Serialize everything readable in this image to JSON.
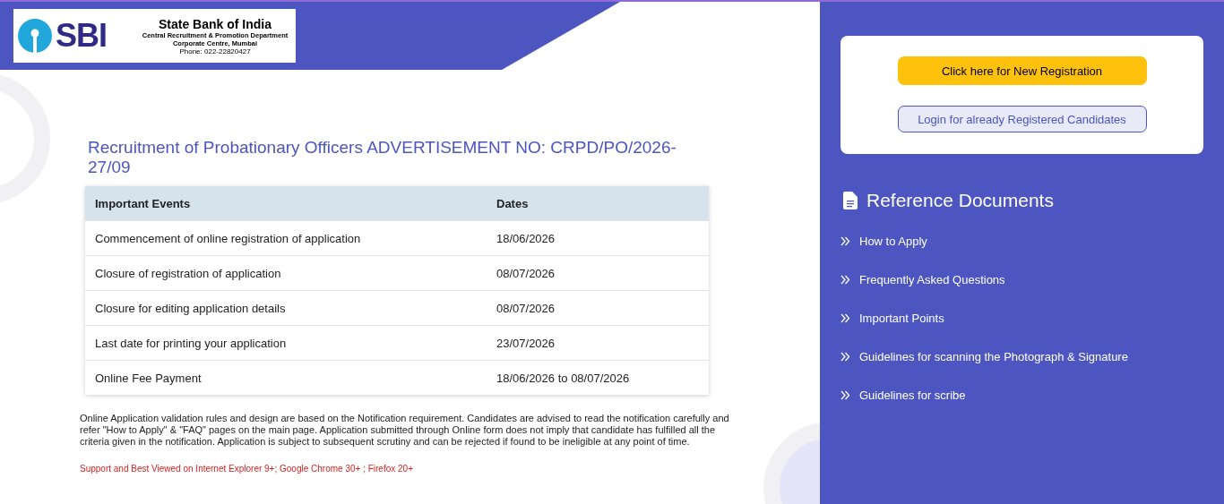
{
  "logo": {
    "mark": "SBI",
    "name": "State Bank of India",
    "department": "Central Recruitment & Promotion Department",
    "office": "Corporate Centre, Mumbai",
    "phone": "Phone: 022-22820427"
  },
  "title": "Recruitment of Probationary Officers ADVERTISEMENT NO: CRPD/PO/2026-27/09",
  "table": {
    "columns": [
      "Important Events",
      "Dates"
    ],
    "rows": [
      [
        "Commencement of online registration of application",
        "18/06/2026"
      ],
      [
        "Closure of registration of application",
        "08/07/2026"
      ],
      [
        "Closure for editing application details",
        "08/07/2026"
      ],
      [
        "Last date for printing your application",
        "23/07/2026"
      ],
      [
        "Online Fee Payment",
        "18/06/2026 to 08/07/2026"
      ]
    ]
  },
  "notice": "Online Application validation rules and design are based on the Notification requirement. Candidates are advised to read the notification carefully and refer \"How to Apply\" & \"FAQ\" pages on the main page. Application submitted through Online form does not imply that candidate has fulfilled all the criteria given in the notification. Application is subject to subsequent scrutiny and can be rejected if found to be ineligible at any point of time.",
  "support": "Support and Best Viewed on Internet Explorer 9+; Google Chrome 30+ ; Firefox 20+",
  "buttons": [
    {
      "label": "Click here for New Registration",
      "kind": "primary"
    },
    {
      "label": "Login for already Registered Candidates",
      "kind": "secondary"
    }
  ],
  "reference": {
    "heading": "Reference Documents",
    "links": [
      "How to Apply",
      "Frequently Asked Questions",
      "Important Points",
      "Guidelines for scanning the Photograph & Signature",
      "Guidelines for scribe"
    ]
  }
}
